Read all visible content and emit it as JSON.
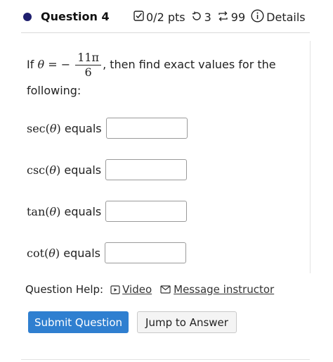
{
  "header": {
    "question_title": "Question 4",
    "points": "0/2 pts",
    "attempts": "3",
    "versions": "99",
    "details_label": "Details",
    "icons": [
      "checkbox-icon",
      "retry-icon",
      "versions-icon",
      "info-icon"
    ]
  },
  "problem": {
    "intro": "If",
    "theta": "θ",
    "equals": "=",
    "minus": "−",
    "numerator": "11π",
    "denominator": "6",
    "rest": ", then find exact values for the",
    "rest2": "following:"
  },
  "questions": [
    {
      "func": "sec",
      "arg": "θ",
      "suffix": "equals",
      "value": ""
    },
    {
      "func": "csc",
      "arg": "θ",
      "suffix": "equals",
      "value": ""
    },
    {
      "func": "tan",
      "arg": "θ",
      "suffix": "equals",
      "value": ""
    },
    {
      "func": "cot",
      "arg": "θ",
      "suffix": "equals",
      "value": ""
    }
  ],
  "help": {
    "label": "Question Help:",
    "video_label": "Video",
    "message_label": "Message instructor"
  },
  "buttons": {
    "submit_label": "Submit Question",
    "jump_label": "Jump to Answer"
  },
  "colors": {
    "primary": "#2f7fd0",
    "dot": "#1f1f6e"
  }
}
